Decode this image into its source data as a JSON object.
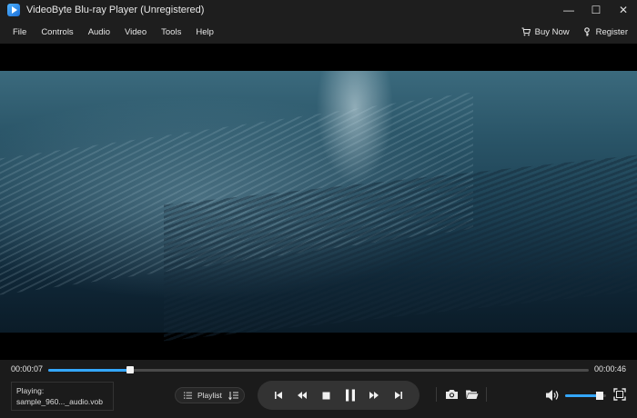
{
  "window": {
    "title": "VideoByte Blu-ray Player (Unregistered)",
    "controls": {
      "minimize": "—",
      "maximize": "☐",
      "close": "✕"
    }
  },
  "menu": {
    "items": [
      "File",
      "Controls",
      "Audio",
      "Video",
      "Tools",
      "Help"
    ],
    "buy_now": "Buy Now",
    "register": "Register"
  },
  "player": {
    "current_time": "00:00:07",
    "total_time": "00:00:46",
    "progress_fraction": 0.152,
    "volume_fraction": 0.85,
    "now_playing_label": "Playing:",
    "now_playing_file": "sample_960..._audio.vob",
    "playlist_label": "Playlist"
  },
  "colors": {
    "accent": "#34a7ff",
    "background": "#1b1b1b",
    "text": "#e6e6e6"
  }
}
